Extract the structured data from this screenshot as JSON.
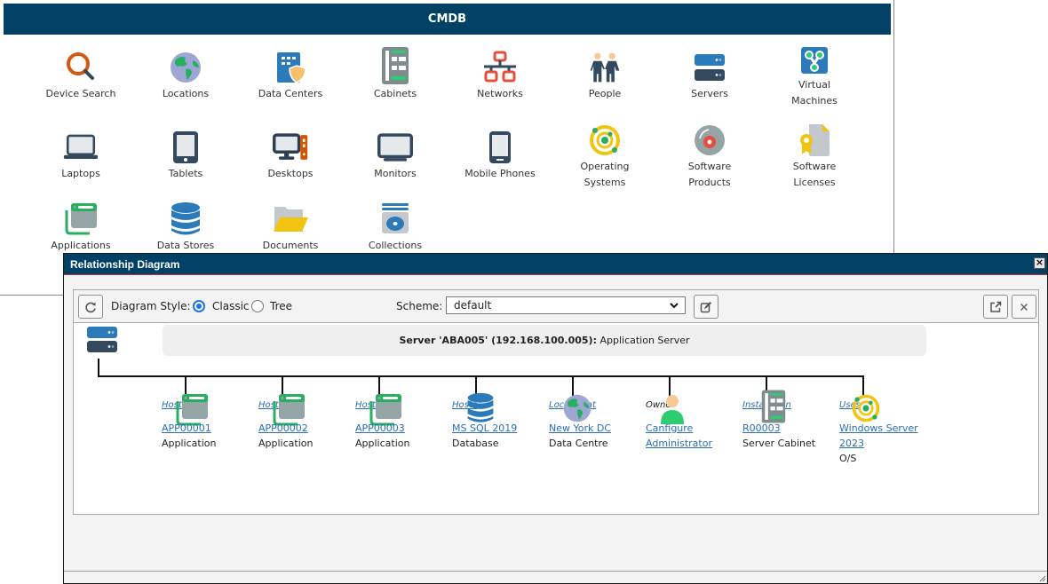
{
  "cmdb": {
    "title": "CMDB",
    "tiles": [
      {
        "label": "Device Search",
        "icon": "magnifier-icon"
      },
      {
        "label": "Locations",
        "icon": "globe-icon"
      },
      {
        "label": "Data Centers",
        "icon": "building-shield-icon"
      },
      {
        "label": "Cabinets",
        "icon": "cabinet-icon"
      },
      {
        "label": "Networks",
        "icon": "network-icon"
      },
      {
        "label": "People",
        "icon": "people-icon"
      },
      {
        "label": "Servers",
        "icon": "server-icon"
      },
      {
        "label": "Virtual Machines",
        "icon": "virtual-machine-icon"
      },
      {
        "label": "Laptops",
        "icon": "laptop-icon"
      },
      {
        "label": "Tablets",
        "icon": "tablet-icon"
      },
      {
        "label": "Desktops",
        "icon": "desktop-icon"
      },
      {
        "label": "Monitors",
        "icon": "monitor-icon"
      },
      {
        "label": "Mobile Phones",
        "icon": "mobile-phone-icon"
      },
      {
        "label": "Operating Systems",
        "icon": "operating-system-icon"
      },
      {
        "label": "Software Products",
        "icon": "software-disc-icon"
      },
      {
        "label": "Software Licenses",
        "icon": "license-certificate-icon"
      },
      {
        "label": "Applications",
        "icon": "application-window-icon"
      },
      {
        "label": "Data Stores",
        "icon": "database-icon"
      },
      {
        "label": "Documents",
        "icon": "folder-icon"
      },
      {
        "label": "Collections",
        "icon": "collection-disc-icon"
      }
    ]
  },
  "dialog": {
    "title": "Relationship Diagram",
    "close_label": "×",
    "toolbar": {
      "diagram_style_label": "Diagram Style:",
      "style_options": [
        {
          "label": "Classic",
          "selected": true
        },
        {
          "label": "Tree",
          "selected": false
        }
      ],
      "scheme_label": "Scheme:",
      "scheme_value": "default"
    },
    "root": {
      "bold_text": "Server 'ABA005' (192.168.100.005):",
      "type_text": " Application Server"
    },
    "nodes": [
      {
        "relation": "Hosts",
        "relation_link": true,
        "name": "APP00001",
        "type": "Application",
        "icon": "application-window-icon"
      },
      {
        "relation": "Hosts",
        "relation_link": true,
        "name": "APP00002",
        "type": "Application",
        "icon": "application-window-icon"
      },
      {
        "relation": "Hosts",
        "relation_link": true,
        "name": "APP00003",
        "type": "Application",
        "icon": "application-window-icon"
      },
      {
        "relation": "Hosts",
        "relation_link": true,
        "name": "MS SQL 2019",
        "type": "Database",
        "icon": "database-icon"
      },
      {
        "relation": "Located at",
        "relation_link": true,
        "name": "New York DC",
        "type": "Data Centre",
        "icon": "globe-icon"
      },
      {
        "relation": "Owner",
        "relation_link": false,
        "name_lines": [
          "Canfigure",
          "Administrator"
        ],
        "type": "",
        "icon": "person-icon"
      },
      {
        "relation": "Installed in",
        "relation_link": true,
        "name": "R00003",
        "type": "Server Cabinet",
        "icon": "cabinet-icon"
      },
      {
        "relation": "Uses",
        "relation_link": true,
        "name_lines": [
          "Windows Server",
          "2023"
        ],
        "type": "O/S",
        "icon": "operating-system-icon"
      }
    ]
  },
  "colors": {
    "header_bg": "#004165",
    "link": "#2a6ebb",
    "radio_accent": "#1a73e8"
  }
}
